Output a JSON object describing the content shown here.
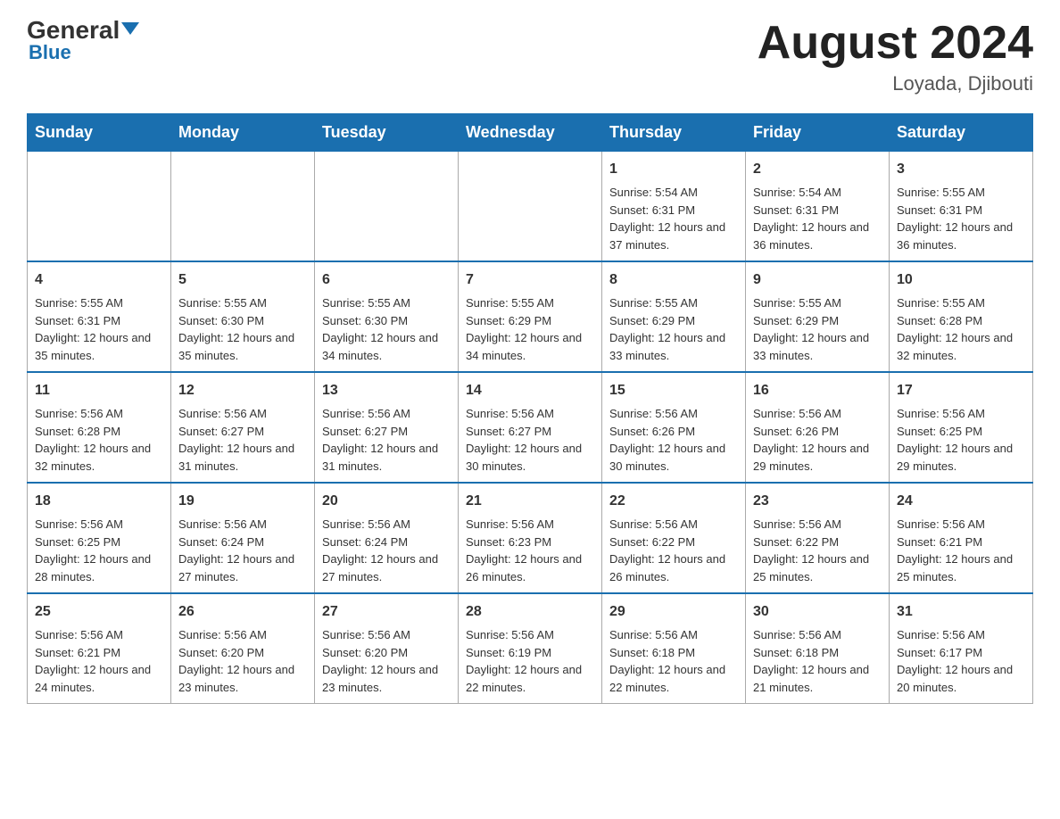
{
  "header": {
    "logo": {
      "general": "General",
      "triangle": "▲",
      "blue": "Blue"
    },
    "title": "August 2024",
    "location": "Loyada, Djibouti"
  },
  "days": [
    "Sunday",
    "Monday",
    "Tuesday",
    "Wednesday",
    "Thursday",
    "Friday",
    "Saturday"
  ],
  "weeks": [
    [
      {
        "day": "",
        "info": ""
      },
      {
        "day": "",
        "info": ""
      },
      {
        "day": "",
        "info": ""
      },
      {
        "day": "",
        "info": ""
      },
      {
        "day": "1",
        "info": "Sunrise: 5:54 AM\nSunset: 6:31 PM\nDaylight: 12 hours and 37 minutes."
      },
      {
        "day": "2",
        "info": "Sunrise: 5:54 AM\nSunset: 6:31 PM\nDaylight: 12 hours and 36 minutes."
      },
      {
        "day": "3",
        "info": "Sunrise: 5:55 AM\nSunset: 6:31 PM\nDaylight: 12 hours and 36 minutes."
      }
    ],
    [
      {
        "day": "4",
        "info": "Sunrise: 5:55 AM\nSunset: 6:31 PM\nDaylight: 12 hours and 35 minutes."
      },
      {
        "day": "5",
        "info": "Sunrise: 5:55 AM\nSunset: 6:30 PM\nDaylight: 12 hours and 35 minutes."
      },
      {
        "day": "6",
        "info": "Sunrise: 5:55 AM\nSunset: 6:30 PM\nDaylight: 12 hours and 34 minutes."
      },
      {
        "day": "7",
        "info": "Sunrise: 5:55 AM\nSunset: 6:29 PM\nDaylight: 12 hours and 34 minutes."
      },
      {
        "day": "8",
        "info": "Sunrise: 5:55 AM\nSunset: 6:29 PM\nDaylight: 12 hours and 33 minutes."
      },
      {
        "day": "9",
        "info": "Sunrise: 5:55 AM\nSunset: 6:29 PM\nDaylight: 12 hours and 33 minutes."
      },
      {
        "day": "10",
        "info": "Sunrise: 5:55 AM\nSunset: 6:28 PM\nDaylight: 12 hours and 32 minutes."
      }
    ],
    [
      {
        "day": "11",
        "info": "Sunrise: 5:56 AM\nSunset: 6:28 PM\nDaylight: 12 hours and 32 minutes."
      },
      {
        "day": "12",
        "info": "Sunrise: 5:56 AM\nSunset: 6:27 PM\nDaylight: 12 hours and 31 minutes."
      },
      {
        "day": "13",
        "info": "Sunrise: 5:56 AM\nSunset: 6:27 PM\nDaylight: 12 hours and 31 minutes."
      },
      {
        "day": "14",
        "info": "Sunrise: 5:56 AM\nSunset: 6:27 PM\nDaylight: 12 hours and 30 minutes."
      },
      {
        "day": "15",
        "info": "Sunrise: 5:56 AM\nSunset: 6:26 PM\nDaylight: 12 hours and 30 minutes."
      },
      {
        "day": "16",
        "info": "Sunrise: 5:56 AM\nSunset: 6:26 PM\nDaylight: 12 hours and 29 minutes."
      },
      {
        "day": "17",
        "info": "Sunrise: 5:56 AM\nSunset: 6:25 PM\nDaylight: 12 hours and 29 minutes."
      }
    ],
    [
      {
        "day": "18",
        "info": "Sunrise: 5:56 AM\nSunset: 6:25 PM\nDaylight: 12 hours and 28 minutes."
      },
      {
        "day": "19",
        "info": "Sunrise: 5:56 AM\nSunset: 6:24 PM\nDaylight: 12 hours and 27 minutes."
      },
      {
        "day": "20",
        "info": "Sunrise: 5:56 AM\nSunset: 6:24 PM\nDaylight: 12 hours and 27 minutes."
      },
      {
        "day": "21",
        "info": "Sunrise: 5:56 AM\nSunset: 6:23 PM\nDaylight: 12 hours and 26 minutes."
      },
      {
        "day": "22",
        "info": "Sunrise: 5:56 AM\nSunset: 6:22 PM\nDaylight: 12 hours and 26 minutes."
      },
      {
        "day": "23",
        "info": "Sunrise: 5:56 AM\nSunset: 6:22 PM\nDaylight: 12 hours and 25 minutes."
      },
      {
        "day": "24",
        "info": "Sunrise: 5:56 AM\nSunset: 6:21 PM\nDaylight: 12 hours and 25 minutes."
      }
    ],
    [
      {
        "day": "25",
        "info": "Sunrise: 5:56 AM\nSunset: 6:21 PM\nDaylight: 12 hours and 24 minutes."
      },
      {
        "day": "26",
        "info": "Sunrise: 5:56 AM\nSunset: 6:20 PM\nDaylight: 12 hours and 23 minutes."
      },
      {
        "day": "27",
        "info": "Sunrise: 5:56 AM\nSunset: 6:20 PM\nDaylight: 12 hours and 23 minutes."
      },
      {
        "day": "28",
        "info": "Sunrise: 5:56 AM\nSunset: 6:19 PM\nDaylight: 12 hours and 22 minutes."
      },
      {
        "day": "29",
        "info": "Sunrise: 5:56 AM\nSunset: 6:18 PM\nDaylight: 12 hours and 22 minutes."
      },
      {
        "day": "30",
        "info": "Sunrise: 5:56 AM\nSunset: 6:18 PM\nDaylight: 12 hours and 21 minutes."
      },
      {
        "day": "31",
        "info": "Sunrise: 5:56 AM\nSunset: 6:17 PM\nDaylight: 12 hours and 20 minutes."
      }
    ]
  ]
}
